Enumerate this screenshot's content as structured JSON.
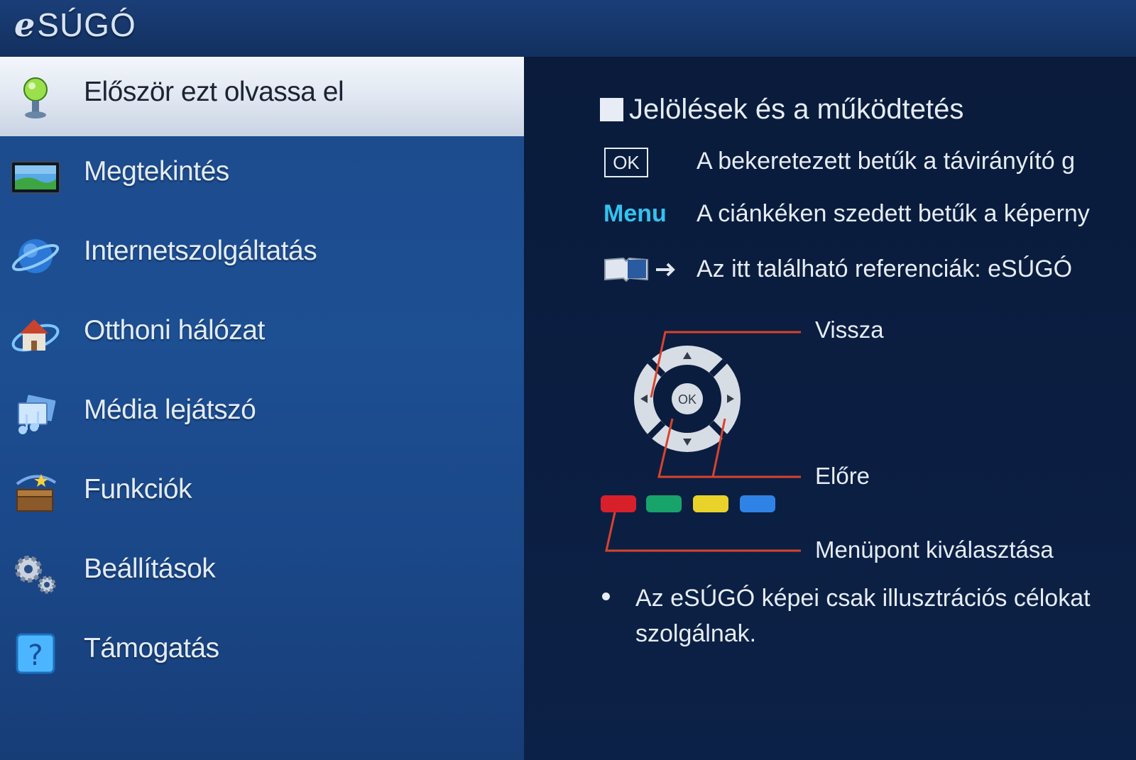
{
  "header": {
    "logo_e": "e",
    "logo_rest": "SÚGÓ"
  },
  "sidebar": {
    "items": [
      {
        "label": "Először ezt olvassa el",
        "icon": "person-info-icon",
        "selected": true
      },
      {
        "label": "Megtekintés",
        "icon": "tv-screen-icon"
      },
      {
        "label": "Internetszolgáltatás",
        "icon": "globe-icon"
      },
      {
        "label": "Otthoni hálózat",
        "icon": "home-network-icon"
      },
      {
        "label": "Média lejátszó",
        "icon": "media-player-icon"
      },
      {
        "label": "Funkciók",
        "icon": "toolbox-icon"
      },
      {
        "label": "Beállítások",
        "icon": "gears-icon"
      },
      {
        "label": "Támogatás",
        "icon": "help-icon"
      }
    ]
  },
  "content": {
    "title": "Jelölések és a működtetés",
    "legend": {
      "ok_symbol": "OK",
      "ok_text": "A bekeretezett betűk a távirányító g",
      "menu_symbol": "Menu",
      "menu_text": "A ciánkéken szedett betűk a képerny",
      "ref_text": "Az itt található referenciák: eSÚGÓ"
    },
    "remote": {
      "ok_label": "OK",
      "back_label": "Vissza",
      "forward_label": "Előre",
      "select_label": "Menüpont kiválasztása"
    },
    "note": "Az eSÚGÓ képei csak illusztrációs célokat szolgálnak."
  },
  "colors": {
    "accent_cyan": "#33c3ef",
    "callout_line": "#d9432c",
    "btn_red": "#d8202a",
    "btn_green": "#17a36a",
    "btn_yellow": "#e9d22a",
    "btn_blue": "#2f83e6"
  }
}
